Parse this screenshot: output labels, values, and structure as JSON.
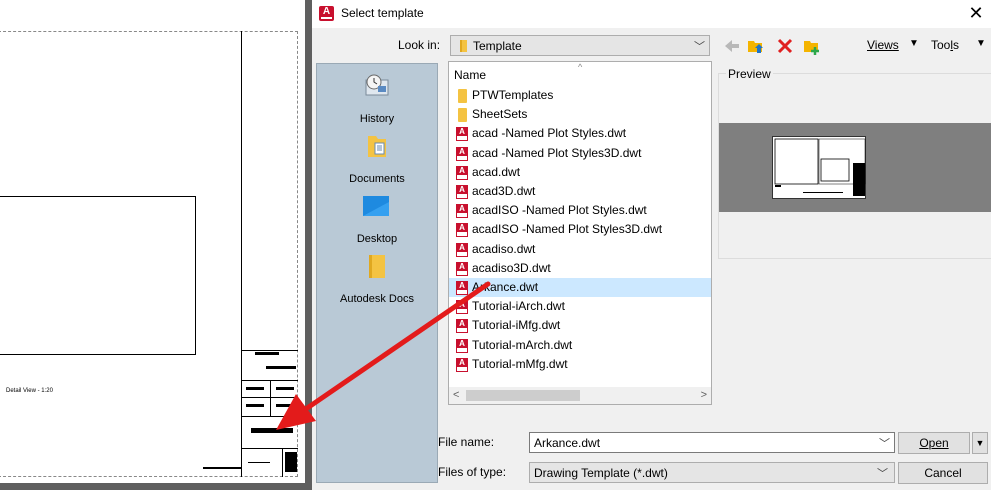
{
  "drawing": {
    "detail_label": "Detail View - 1:20"
  },
  "dialog": {
    "title": "Select template",
    "close_glyph": "✕",
    "look_in_label": "Look in:",
    "look_in_value": "Template",
    "toolbar": {
      "icons": [
        "back-icon",
        "up-folder-icon",
        "delete-icon",
        "new-folder-icon"
      ],
      "views_label": "Views",
      "tools_label": "Tools"
    },
    "places": [
      {
        "label": "History",
        "icon": "history-icon"
      },
      {
        "label": "Documents",
        "icon": "documents-icon"
      },
      {
        "label": "Desktop",
        "icon": "desktop-icon"
      },
      {
        "label": "Autodesk Docs",
        "icon": "autodesk-docs-icon"
      }
    ],
    "file_list": {
      "column_header": "Name",
      "items": [
        {
          "name": "PTWTemplates",
          "type": "folder",
          "selected": false
        },
        {
          "name": "SheetSets",
          "type": "folder",
          "selected": false
        },
        {
          "name": "acad -Named Plot Styles.dwt",
          "type": "dwt",
          "selected": false
        },
        {
          "name": "acad -Named Plot Styles3D.dwt",
          "type": "dwt",
          "selected": false
        },
        {
          "name": "acad.dwt",
          "type": "dwt",
          "selected": false
        },
        {
          "name": "acad3D.dwt",
          "type": "dwt",
          "selected": false
        },
        {
          "name": "acadISO -Named Plot Styles.dwt",
          "type": "dwt",
          "selected": false
        },
        {
          "name": "acadISO -Named Plot Styles3D.dwt",
          "type": "dwt",
          "selected": false
        },
        {
          "name": "acadiso.dwt",
          "type": "dwt",
          "selected": false
        },
        {
          "name": "acadiso3D.dwt",
          "type": "dwt",
          "selected": false
        },
        {
          "name": "Arkance.dwt",
          "type": "dwt",
          "selected": true
        },
        {
          "name": "Tutorial-iArch.dwt",
          "type": "dwt",
          "selected": false
        },
        {
          "name": "Tutorial-iMfg.dwt",
          "type": "dwt",
          "selected": false
        },
        {
          "name": "Tutorial-mArch.dwt",
          "type": "dwt",
          "selected": false
        },
        {
          "name": "Tutorial-mMfg.dwt",
          "type": "dwt",
          "selected": false
        }
      ]
    },
    "preview_label": "Preview",
    "file_name_label": "File name:",
    "file_name_value": "Arkance.dwt",
    "files_of_type_label": "Files of type:",
    "files_of_type_value": "Drawing Template (*.dwt)",
    "open_label": "Open",
    "cancel_label": "Cancel"
  },
  "colors": {
    "accent_red": "#c8102e",
    "selection": "#cce8ff",
    "places_bg": "#b9c9d6",
    "arrow_red": "#e31b1b"
  }
}
